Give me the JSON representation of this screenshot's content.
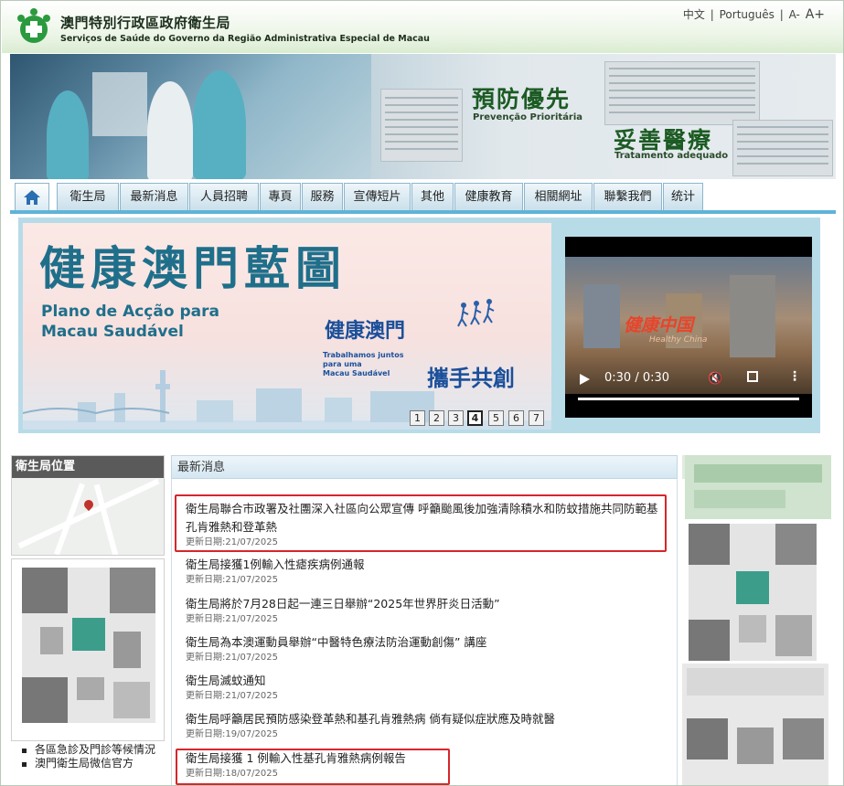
{
  "header": {
    "title_zh": "澳門特別行政區政府衛生局",
    "title_pt": "Serviços de Saúde do Governo da Região Administrativa Especial de Macau",
    "lang_zh": "中文",
    "lang_sep1": "|",
    "lang_pt": "Português",
    "lang_sep2": "|",
    "font_small": "A-",
    "font_big": "A+"
  },
  "banner": {
    "slogan1": "預防優先",
    "slogan1_pt": "Prevenção Prioritária",
    "slogan2": "妥善醫療",
    "slogan2_pt": "Tratamento adequado"
  },
  "nav": {
    "home_icon": "home-icon",
    "tabs": [
      "衛生局",
      "最新消息",
      "人員招聘",
      "專頁",
      "服務",
      "宣傳短片",
      "其他",
      "健康教育",
      "相關網址",
      "聯繫我們",
      "统计"
    ]
  },
  "slide": {
    "title": "健康澳門藍圖",
    "subtitle_line1": "Plano de Acção para",
    "subtitle_line2": "Macau Saudável",
    "tag_zh1": "健康澳門",
    "tag_zh2": "攜手共創",
    "tag_small1": "Trabalhamos juntos",
    "tag_small2": "para uma",
    "tag_small3": "Macau Saudável",
    "pages": [
      "1",
      "2",
      "3",
      "4",
      "5",
      "6",
      "7"
    ],
    "active_page": "4"
  },
  "video": {
    "overlay_text": "健康中国",
    "overlay_sub": "Healthy China",
    "time": "0:30 / 0:30",
    "progress": 1.0,
    "play_icon": "play-icon",
    "mute_icon": "mute-icon",
    "fullscreen_icon": "fullscreen-icon",
    "more_icon": "more-vert-icon"
  },
  "left": {
    "map_title": "衛生局位置",
    "quick_links": [
      "各區急診及門診等候情況",
      "澳門衛生局微信官方"
    ]
  },
  "news": {
    "heading": "最新消息",
    "items": [
      {
        "title": "衛生局聯合市政署及社團深入社區向公眾宣傳 呼籲颱風後加強清除積水和防蚊措施共同防範基孔肯雅熱和登革熱",
        "date": "更新日期:21/07/2025",
        "highlight": true
      },
      {
        "title": "衛生局接獲1例輸入性瘧疾病例通報",
        "date": "更新日期:21/07/2025",
        "highlight": false
      },
      {
        "title": "衛生局將於7月28日起一連三日舉辦“2025年世界肝炎日活動”",
        "date": "更新日期:21/07/2025",
        "highlight": false
      },
      {
        "title": "衛生局為本澳運動員舉辦“中醫特色療法防治運動創傷” 講座",
        "date": "更新日期:21/07/2025",
        "highlight": false
      },
      {
        "title": "衛生局滅蚊通知",
        "date": "更新日期:21/07/2025",
        "highlight": false
      },
      {
        "title": "衛生局呼籲居民預防感染登革熱和基孔肯雅熱病 倘有疑似症狀應及時就醫",
        "date": "更新日期:19/07/2025",
        "highlight": false
      },
      {
        "title": "衛生局接獲 1 例輸入性基孔肯雅熱病例報告",
        "date": "更新日期:18/07/2025",
        "highlight": true
      }
    ]
  },
  "colors": {
    "accent": "#5fb3d8",
    "highlight_border": "#d6262b",
    "brand_green": "#1c5b23"
  }
}
